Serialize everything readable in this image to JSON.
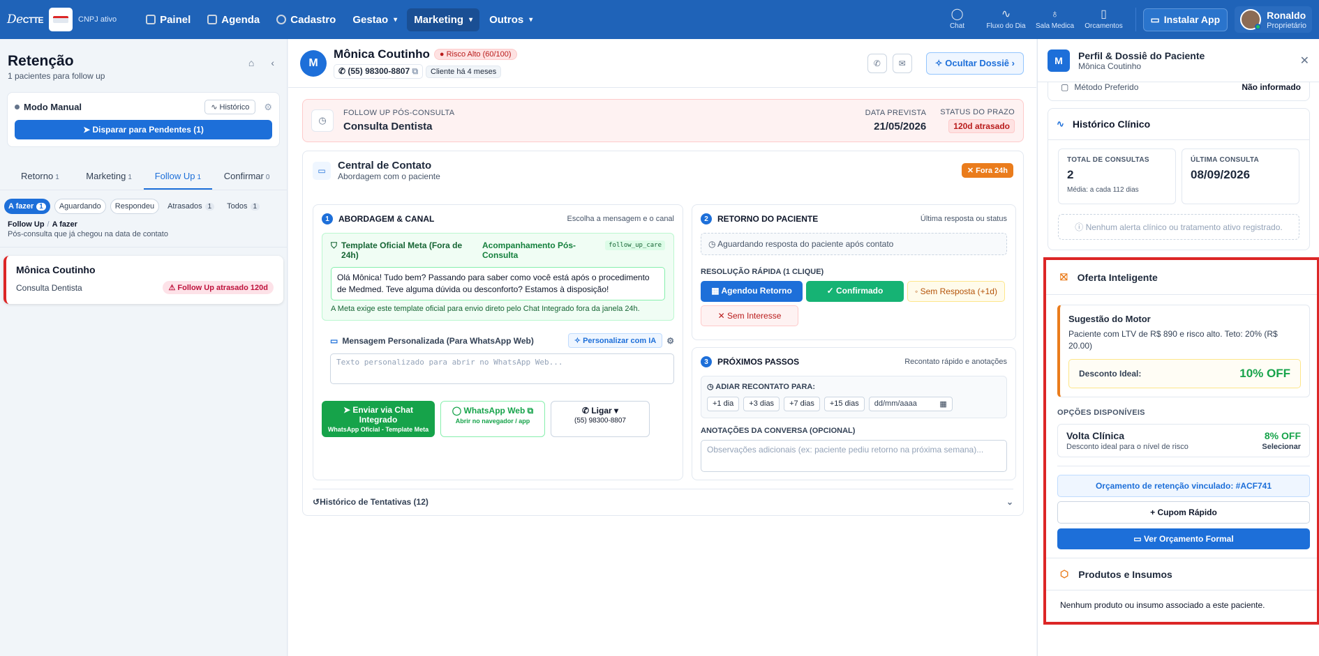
{
  "app": {
    "logo": "DeCTTE",
    "org_status": "CNPJ ativo"
  },
  "nav": [
    {
      "label": "Painel",
      "icon": "grid-icon",
      "dropdown": false
    },
    {
      "label": "Agenda",
      "icon": "calendar-icon",
      "dropdown": false
    },
    {
      "label": "Cadastro",
      "icon": "database-icon",
      "dropdown": false
    },
    {
      "label": "Gestao",
      "icon": "",
      "dropdown": true
    },
    {
      "label": "Marketing",
      "icon": "",
      "dropdown": true,
      "active": true
    },
    {
      "label": "Outros",
      "icon": "",
      "dropdown": true
    }
  ],
  "toplinks": [
    {
      "label": "Chat",
      "icon": "chat-icon"
    },
    {
      "label": "Fluxo do Dia",
      "icon": "activity-icon"
    },
    {
      "label": "Sala Medica",
      "icon": "stethoscope-icon"
    },
    {
      "label": "Orcamentos",
      "icon": "document-icon"
    }
  ],
  "install_label": "Instalar App",
  "user": {
    "name": "Ronaldo",
    "role": "Proprietário"
  },
  "left": {
    "title": "Retenção",
    "subtitle": "1 pacientes para follow up",
    "mode_label": "Modo Manual",
    "history_label": "Histórico",
    "dispatch_label": "Disparar para Pendentes (1)",
    "tabs": [
      {
        "label": "Retorno",
        "count": "1"
      },
      {
        "label": "Marketing",
        "count": "1"
      },
      {
        "label": "Follow Up",
        "count": "1",
        "active": true
      },
      {
        "label": "Confirmar",
        "count": "0"
      }
    ],
    "chips": [
      {
        "label": "A fazer",
        "count": "1",
        "active": true
      },
      {
        "label": "Aguardando",
        "count": ""
      },
      {
        "label": "Respondeu",
        "count": ""
      },
      {
        "label": "Atrasados",
        "count": "1"
      },
      {
        "label": "Todos",
        "count": "1"
      }
    ],
    "crumb1": "Follow Up",
    "crumb2": "A fazer",
    "crumb_desc": "Pós-consulta que já chegou na data de contato",
    "patient": {
      "name": "Mônica Coutinho",
      "procedure": "Consulta Dentista",
      "badge": "Follow Up atrasado 120d"
    }
  },
  "patient": {
    "initial": "M",
    "name": "Mônica Coutinho",
    "risk": "Risco Alto",
    "risk_score": "(60/100)",
    "phone": "(55) 98300-8807",
    "since": "Cliente há 4 meses",
    "hide_dossier": "Ocultar Dossiê"
  },
  "followup": {
    "label": "FOLLOW UP PÓS-CONSULTA",
    "title": "Consulta Dentista",
    "date_label": "DATA PREVISTA",
    "date": "21/05/2026",
    "status_label": "STATUS DO PRAZO",
    "status": "120d atrasado"
  },
  "central": {
    "title": "Central de Contato",
    "subtitle": "Abordagem com o paciente",
    "badge": "Fora 24h",
    "s1_num": "1",
    "s1_title": "ABORDAGEM & CANAL",
    "s1_hint": "Escolha a mensagem e o canal",
    "tmpl_title": "Template Oficial Meta (Fora de 24h)",
    "tmpl_name": "Acompanhamento Pós-Consulta",
    "tmpl_code": "follow_up_care",
    "tmpl_msg": "Olá Mônica! Tudo bem? Passando para saber como você está após o procedimento de Medmed. Teve alguma dúvida ou desconforto? Estamos à disposição!",
    "tmpl_note": "A Meta exige este template oficial para envio direto pelo Chat Integrado fora da janela 24h.",
    "custom_label": "Mensagem Personalizada (Para WhatsApp Web)",
    "ia_label": "Personalizar com IA",
    "custom_placeholder": "Texto personalizado para abrir no WhatsApp Web...",
    "send_label": "Enviar via Chat Integrado",
    "send_sub": "WhatsApp Oficial - Template Meta",
    "wa_label": "WhatsApp Web",
    "wa_sub": "Abrir no navegador / app",
    "call_label": "Ligar",
    "call_sub": "(55) 98300-8807",
    "s2_num": "2",
    "s2_title": "RETORNO DO PACIENTE",
    "s2_hint": "Última resposta ou status",
    "waiting": "Aguardando resposta do paciente após contato",
    "quick_label": "RESOLUÇÃO RÁPIDA (1 CLIQUE)",
    "quick": [
      "Agendou Retorno",
      "Confirmado",
      "Sem Resposta (+1d)",
      "Sem Interesse"
    ],
    "s3_num": "3",
    "s3_title": "PRÓXIMOS PASSOS",
    "s3_hint": "Recontato rápido e anotações",
    "postpone_label": "ADIAR RECONTATO PARA:",
    "postpone": [
      "+1 dia",
      "+3 dias",
      "+7 dias",
      "+15 dias"
    ],
    "date_placeholder": "dd/mm/aaaa",
    "notes_label": "ANOTAÇÕES DA CONVERSA (OPCIONAL)",
    "notes_placeholder": "Observações adicionais (ex: paciente pediu retorno na próxima semana)...",
    "attempts": "Histórico de Tentativas (12)"
  },
  "dossier": {
    "initial": "M",
    "title": "Perfil & Dossiê do Paciente",
    "subtitle": "Mônica Coutinho",
    "method_label": "Método Preferido",
    "method_value": "Não informado",
    "clinical_title": "Histórico Clínico",
    "total_label": "TOTAL DE CONSULTAS",
    "total_value": "2",
    "total_sub": "Média: a cada 112 dias",
    "last_label": "ÚLTIMA CONSULTA",
    "last_value": "08/09/2026",
    "no_alert": "Nenhum alerta clínico ou tratamento ativo registrado.",
    "offer_title": "Oferta Inteligente",
    "sug_title": "Sugestão do Motor",
    "sug_desc": "Paciente com LTV de R$ 890 e risco alto. Teto: 20% (R$ 20.00)",
    "ideal_label": "Desconto Ideal:",
    "ideal_value": "10% OFF",
    "options_label": "OPÇÕES DISPONÍVEIS",
    "option_title": "Volta Clínica",
    "option_sub": "Desconto ideal para o nível de risco",
    "option_value": "8% OFF",
    "option_select": "Selecionar",
    "linked": "Orçamento de retenção vinculado: #ACF741",
    "coupon": "Cupom Rápido",
    "formal": "Ver Orçamento Formal",
    "products_title": "Produtos e Insumos",
    "products_text": "Nenhum produto ou insumo associado a este paciente."
  }
}
